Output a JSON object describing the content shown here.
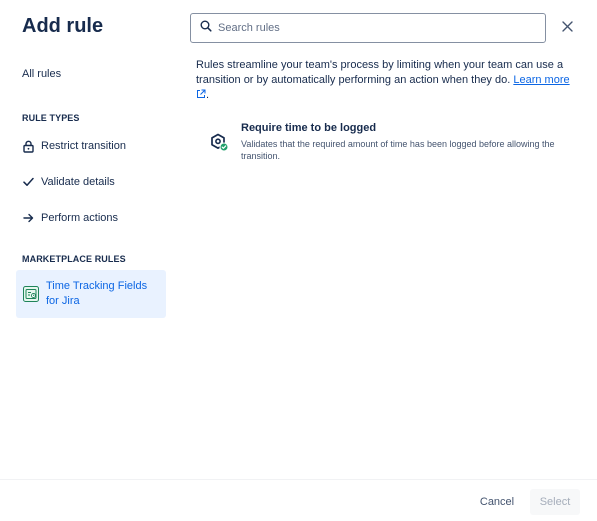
{
  "dialog": {
    "title": "Add rule",
    "close_icon": "close-icon"
  },
  "sidebar": {
    "all_rules": "All rules",
    "rule_types_heading": "RULE TYPES",
    "rule_types": [
      {
        "label": "Restrict transition",
        "icon": "lock-icon"
      },
      {
        "label": "Validate details",
        "icon": "check-icon"
      },
      {
        "label": "Perform actions",
        "icon": "arrow-right-icon"
      }
    ],
    "marketplace_heading": "MARKETPLACE RULES",
    "marketplace_items": [
      {
        "label": "Time Tracking Fields for Jira",
        "icon": "time-tracking-app-icon",
        "selected": true
      }
    ]
  },
  "search": {
    "placeholder": "Search rules",
    "value": ""
  },
  "intro": {
    "text": "Rules streamline your team's process by limiting when your team can use a transition or by automatically performing an action when they do.",
    "link_label": "Learn more",
    "link_icon": "external-link-icon"
  },
  "rules": [
    {
      "title": "Require time to be logged",
      "description": "Validates that the required amount of time has been logged before allowing the transition.",
      "icon": "time-logged-rule-icon"
    }
  ],
  "footer": {
    "cancel_label": "Cancel",
    "select_label": "Select"
  },
  "colors": {
    "accent": "#0c66e4",
    "selected_bg": "#e9f2ff",
    "text": "#172b4d"
  }
}
